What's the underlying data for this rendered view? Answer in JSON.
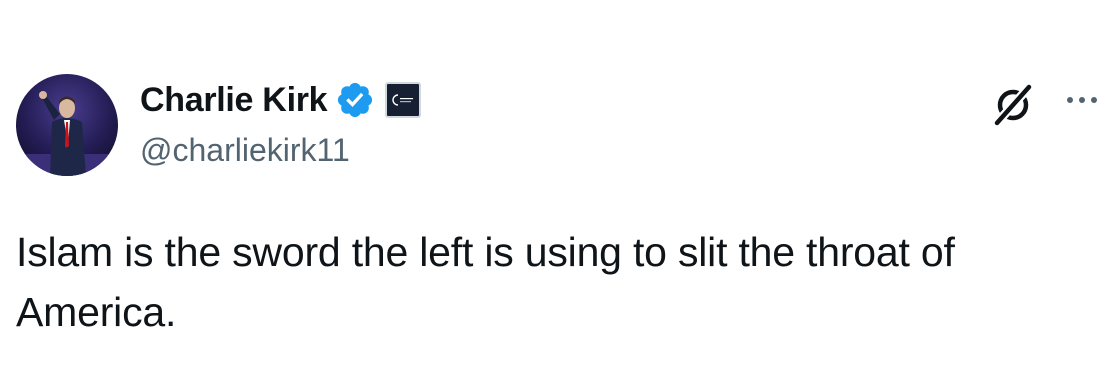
{
  "author": {
    "display_name": "Charlie Kirk",
    "handle": "@charliekirk11",
    "verified": true,
    "verified_color": "#1d9bf0",
    "avatar_icon": "profile-photo"
  },
  "header_actions": {
    "grok_icon": "grok-icon",
    "more_icon": "more-options-icon"
  },
  "tweet": {
    "text": "Islam is the sword the left is using to slit the throat of America."
  },
  "colors": {
    "text_primary": "#0f1419",
    "text_secondary": "#536471",
    "badge_blue": "#1d9bf0"
  }
}
